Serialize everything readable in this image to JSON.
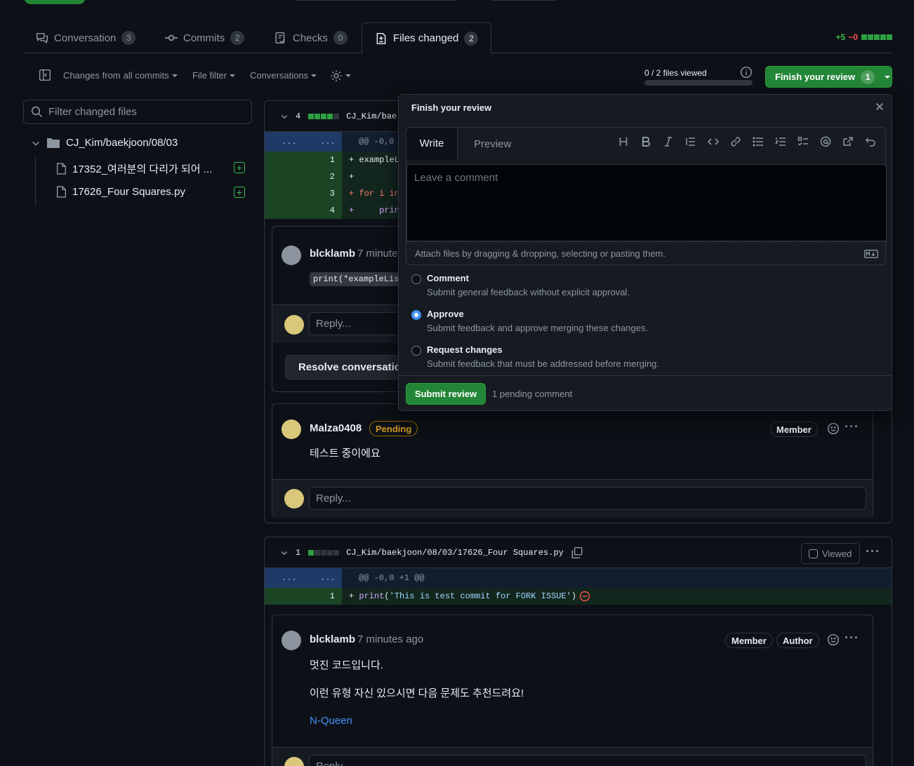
{
  "tabs": [
    {
      "label": "Conversation",
      "count": "3"
    },
    {
      "label": "Commits",
      "count": "2"
    },
    {
      "label": "Checks",
      "count": "0"
    },
    {
      "label": "Files changed",
      "count": "2"
    }
  ],
  "diffstat": {
    "add": "+5",
    "del": "−0"
  },
  "toolbar": {
    "changes_prefix": "Changes from",
    "changes_bold": "all commits",
    "file_filter": "File filter",
    "conversations": "Conversations",
    "files_viewed": "0 / 2 files viewed",
    "finish_review": "Finish your review",
    "finish_count": "1"
  },
  "sidebar": {
    "filter_placeholder": "Filter changed files",
    "folder": "CJ_Kim/baekjoon/08/03",
    "files": [
      "17352_여러분의 다리가 되어 ...",
      "17626_Four Squares.py"
    ]
  },
  "file1": {
    "count": "4",
    "path": "CJ_Kim/bae",
    "hunk_l": "...",
    "hunk_r": "...",
    "hunk": "@@ -0,0",
    "lines": [
      {
        "n": "1",
        "code": "+ exampleL"
      },
      {
        "n": "2",
        "code": "+"
      },
      {
        "n": "3",
        "code": "+ for i in"
      },
      {
        "n": "4",
        "code": "+     prin"
      }
    ]
  },
  "thread1": {
    "author": "blcklamb",
    "time": "7 minute",
    "code": "print(*exampleLis",
    "reply": "Reply...",
    "resolve": "Resolve conversation"
  },
  "thread2": {
    "author": "Malza0408",
    "pending": "Pending",
    "member": "Member",
    "body": "테스트 중이에요",
    "reply": "Reply..."
  },
  "file2": {
    "count": "1",
    "path": "CJ_Kim/baekjoon/08/03/17626_Four Squares.py",
    "viewed": "Viewed",
    "hunk_l": "...",
    "hunk_r": "...",
    "hunk": "@@ -0,0 +1 @@",
    "line_n": "1",
    "line_prefix": "+ ",
    "line_fn": "print",
    "line_open": "(",
    "line_str": "'This is test commit for FORK ISSUE'",
    "line_close": ")"
  },
  "thread3": {
    "author": "blcklamb",
    "time": "7 minutes ago",
    "member": "Member",
    "author_badge": "Author",
    "body1": "멋진 코드입니다.",
    "body2": "이런 유형 자신 있으시면 다음 문제도 추천드려요!",
    "link": "N-Queen",
    "reply": "Reply..."
  },
  "review": {
    "title": "Finish your review",
    "write": "Write",
    "preview": "Preview",
    "placeholder": "Leave a comment",
    "attach": "Attach files by dragging & dropping, selecting or pasting them.",
    "options": [
      {
        "title": "Comment",
        "desc": "Submit general feedback without explicit approval.",
        "selected": false
      },
      {
        "title": "Approve",
        "desc": "Submit feedback and approve merging these changes.",
        "selected": true
      },
      {
        "title": "Request changes",
        "desc": "Submit feedback that must be addressed before merging.",
        "selected": false
      }
    ],
    "submit": "Submit review",
    "pending": "1 pending comment"
  },
  "colors": {
    "accent": "#238636",
    "bg": "#0d1117",
    "link": "#4493f8",
    "pending": "#d29922"
  }
}
